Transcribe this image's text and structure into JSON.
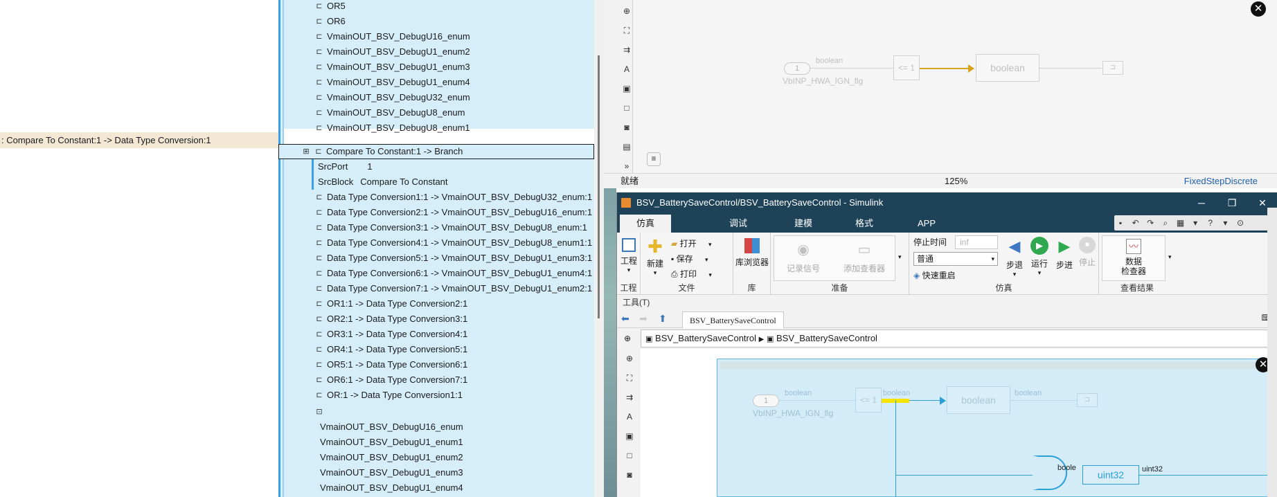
{
  "left_pane": {
    "highlight_text": ": Compare To Constant:1 -> Data Type Conversion:1"
  },
  "tree": {
    "top_items": [
      "OR5",
      "OR6",
      "VmainOUT_BSV_DebugU16_enum",
      "VmainOUT_BSV_DebugU1_enum2",
      "VmainOUT_BSV_DebugU1_enum3",
      "VmainOUT_BSV_DebugU1_enum4",
      "VmainOUT_BSV_DebugU32_enum",
      "VmainOUT_BSV_DebugU8_enum",
      "VmainOUT_BSV_DebugU8_enum1"
    ],
    "selected_item": "Compare To Constant:1 -> Branch",
    "props": [
      {
        "key": "SrcPort",
        "value": "1"
      },
      {
        "key": "SrcBlock",
        "value": "Compare To Constant"
      }
    ],
    "line_items": [
      "Data Type Conversion1:1 -> VmainOUT_BSV_DebugU32_enum:1",
      "Data Type Conversion2:1 -> VmainOUT_BSV_DebugU16_enum:1",
      "Data Type Conversion3:1 -> VmainOUT_BSV_DebugU8_enum:1",
      "Data Type Conversion4:1 -> VmainOUT_BSV_DebugU8_enum1:1",
      "Data Type Conversion5:1 -> VmainOUT_BSV_DebugU1_enum3:1",
      "Data Type Conversion6:1 -> VmainOUT_BSV_DebugU1_enum4:1",
      "Data Type Conversion7:1 -> VmainOUT_BSV_DebugU1_enum2:1",
      "OR1:1 -> Data Type Conversion2:1",
      "OR2:1 -> Data Type Conversion3:1",
      "OR3:1 -> Data Type Conversion4:1",
      "OR4:1 -> Data Type Conversion5:1",
      "OR5:1 -> Data Type Conversion6:1",
      "OR6:1 -> Data Type Conversion7:1",
      "OR:1 -> Data Type Conversion1:1"
    ],
    "bottom_items": [
      "VmainOUT_BSV_DebugU16_enum",
      "VmainOUT_BSV_DebugU1_enum1",
      "VmainOUT_BSV_DebugU1_enum2",
      "VmainOUT_BSV_DebugU1_enum3",
      "VmainOUT_BSV_DebugU1_enum4"
    ]
  },
  "top_editor": {
    "status_left": "就绪",
    "zoom": "125%",
    "solver": "FixedStepDiscrete",
    "inport_num": "1",
    "signal_label": "boolean",
    "inport_name": "VbINP_HWA_IGN_flg",
    "compare_label": "<= 1",
    "convert_label": "boolean"
  },
  "main_window": {
    "title": "BSV_BatterySaveControl/BSV_BatterySaveControl - Simulink",
    "tabs": [
      "仿真",
      "调试",
      "建模",
      "格式",
      "APP"
    ],
    "active_tab": "仿真",
    "ribbon": {
      "project_label": "工程",
      "new_label": "新建",
      "open_label": "打开",
      "save_label": "保存",
      "print_label": "打印",
      "library_label": "库浏览器",
      "record_label": "记录信号",
      "add_viewer_label": "添加查看器",
      "stop_time_label": "停止时间",
      "stop_time_value": "inf",
      "mode_value": "普通",
      "fast_restart_label": "快速重启",
      "step_back_label": "步退",
      "run_label": "运行",
      "step_forward_label": "步进",
      "stop_label": "停止",
      "data_inspector_label_1": "数据",
      "data_inspector_label_2": "检查器",
      "groups": {
        "project": "工程",
        "file": "文件",
        "library": "库",
        "prepare": "准备",
        "simulate": "仿真",
        "review": "查看结果"
      }
    },
    "tools_menu": "工具(T)",
    "model_tab": "BSV_BatterySaveControl",
    "breadcrumb": [
      "BSV_BatterySaveControl",
      "BSV_BatterySaveControl"
    ],
    "canvas": {
      "inport_num": "1",
      "signal_label": "boolean",
      "inport_name": "VbINP_HWA_IGN_flg",
      "compare_label": "<= 1",
      "compare_out_label": "boolean",
      "convert_label": "boolean",
      "convert_out_label": "boolean",
      "uint32_label": "uint32",
      "uint32_out_label": "uint32",
      "or_in_label": "boole"
    }
  },
  "colors": {
    "accent_blue": "#3a9ee8",
    "tree_bg": "#d6eef9",
    "title_bar": "#1e4359",
    "highlight_row": "#f2e8d4",
    "signal_orange": "#d9a21b",
    "signal_blue": "#2a9fd8",
    "selected_wire_yellow": "#f5e400"
  }
}
